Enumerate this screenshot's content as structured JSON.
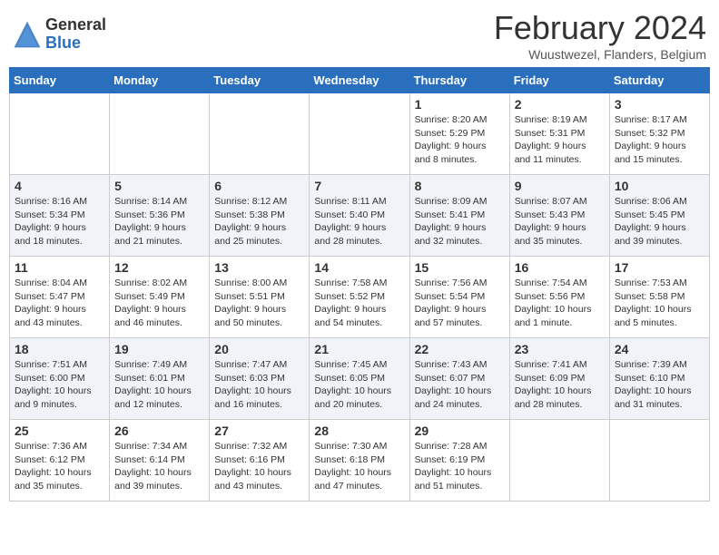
{
  "header": {
    "logo_general": "General",
    "logo_blue": "Blue",
    "main_title": "February 2024",
    "subtitle": "Wuustwezel, Flanders, Belgium"
  },
  "days_of_week": [
    "Sunday",
    "Monday",
    "Tuesday",
    "Wednesday",
    "Thursday",
    "Friday",
    "Saturday"
  ],
  "weeks": [
    [
      {
        "day": "",
        "info": ""
      },
      {
        "day": "",
        "info": ""
      },
      {
        "day": "",
        "info": ""
      },
      {
        "day": "",
        "info": ""
      },
      {
        "day": "1",
        "info": "Sunrise: 8:20 AM\nSunset: 5:29 PM\nDaylight: 9 hours\nand 8 minutes."
      },
      {
        "day": "2",
        "info": "Sunrise: 8:19 AM\nSunset: 5:31 PM\nDaylight: 9 hours\nand 11 minutes."
      },
      {
        "day": "3",
        "info": "Sunrise: 8:17 AM\nSunset: 5:32 PM\nDaylight: 9 hours\nand 15 minutes."
      }
    ],
    [
      {
        "day": "4",
        "info": "Sunrise: 8:16 AM\nSunset: 5:34 PM\nDaylight: 9 hours\nand 18 minutes."
      },
      {
        "day": "5",
        "info": "Sunrise: 8:14 AM\nSunset: 5:36 PM\nDaylight: 9 hours\nand 21 minutes."
      },
      {
        "day": "6",
        "info": "Sunrise: 8:12 AM\nSunset: 5:38 PM\nDaylight: 9 hours\nand 25 minutes."
      },
      {
        "day": "7",
        "info": "Sunrise: 8:11 AM\nSunset: 5:40 PM\nDaylight: 9 hours\nand 28 minutes."
      },
      {
        "day": "8",
        "info": "Sunrise: 8:09 AM\nSunset: 5:41 PM\nDaylight: 9 hours\nand 32 minutes."
      },
      {
        "day": "9",
        "info": "Sunrise: 8:07 AM\nSunset: 5:43 PM\nDaylight: 9 hours\nand 35 minutes."
      },
      {
        "day": "10",
        "info": "Sunrise: 8:06 AM\nSunset: 5:45 PM\nDaylight: 9 hours\nand 39 minutes."
      }
    ],
    [
      {
        "day": "11",
        "info": "Sunrise: 8:04 AM\nSunset: 5:47 PM\nDaylight: 9 hours\nand 43 minutes."
      },
      {
        "day": "12",
        "info": "Sunrise: 8:02 AM\nSunset: 5:49 PM\nDaylight: 9 hours\nand 46 minutes."
      },
      {
        "day": "13",
        "info": "Sunrise: 8:00 AM\nSunset: 5:51 PM\nDaylight: 9 hours\nand 50 minutes."
      },
      {
        "day": "14",
        "info": "Sunrise: 7:58 AM\nSunset: 5:52 PM\nDaylight: 9 hours\nand 54 minutes."
      },
      {
        "day": "15",
        "info": "Sunrise: 7:56 AM\nSunset: 5:54 PM\nDaylight: 9 hours\nand 57 minutes."
      },
      {
        "day": "16",
        "info": "Sunrise: 7:54 AM\nSunset: 5:56 PM\nDaylight: 10 hours\nand 1 minute."
      },
      {
        "day": "17",
        "info": "Sunrise: 7:53 AM\nSunset: 5:58 PM\nDaylight: 10 hours\nand 5 minutes."
      }
    ],
    [
      {
        "day": "18",
        "info": "Sunrise: 7:51 AM\nSunset: 6:00 PM\nDaylight: 10 hours\nand 9 minutes."
      },
      {
        "day": "19",
        "info": "Sunrise: 7:49 AM\nSunset: 6:01 PM\nDaylight: 10 hours\nand 12 minutes."
      },
      {
        "day": "20",
        "info": "Sunrise: 7:47 AM\nSunset: 6:03 PM\nDaylight: 10 hours\nand 16 minutes."
      },
      {
        "day": "21",
        "info": "Sunrise: 7:45 AM\nSunset: 6:05 PM\nDaylight: 10 hours\nand 20 minutes."
      },
      {
        "day": "22",
        "info": "Sunrise: 7:43 AM\nSunset: 6:07 PM\nDaylight: 10 hours\nand 24 minutes."
      },
      {
        "day": "23",
        "info": "Sunrise: 7:41 AM\nSunset: 6:09 PM\nDaylight: 10 hours\nand 28 minutes."
      },
      {
        "day": "24",
        "info": "Sunrise: 7:39 AM\nSunset: 6:10 PM\nDaylight: 10 hours\nand 31 minutes."
      }
    ],
    [
      {
        "day": "25",
        "info": "Sunrise: 7:36 AM\nSunset: 6:12 PM\nDaylight: 10 hours\nand 35 minutes."
      },
      {
        "day": "26",
        "info": "Sunrise: 7:34 AM\nSunset: 6:14 PM\nDaylight: 10 hours\nand 39 minutes."
      },
      {
        "day": "27",
        "info": "Sunrise: 7:32 AM\nSunset: 6:16 PM\nDaylight: 10 hours\nand 43 minutes."
      },
      {
        "day": "28",
        "info": "Sunrise: 7:30 AM\nSunset: 6:18 PM\nDaylight: 10 hours\nand 47 minutes."
      },
      {
        "day": "29",
        "info": "Sunrise: 7:28 AM\nSunset: 6:19 PM\nDaylight: 10 hours\nand 51 minutes."
      },
      {
        "day": "",
        "info": ""
      },
      {
        "day": "",
        "info": ""
      }
    ]
  ]
}
